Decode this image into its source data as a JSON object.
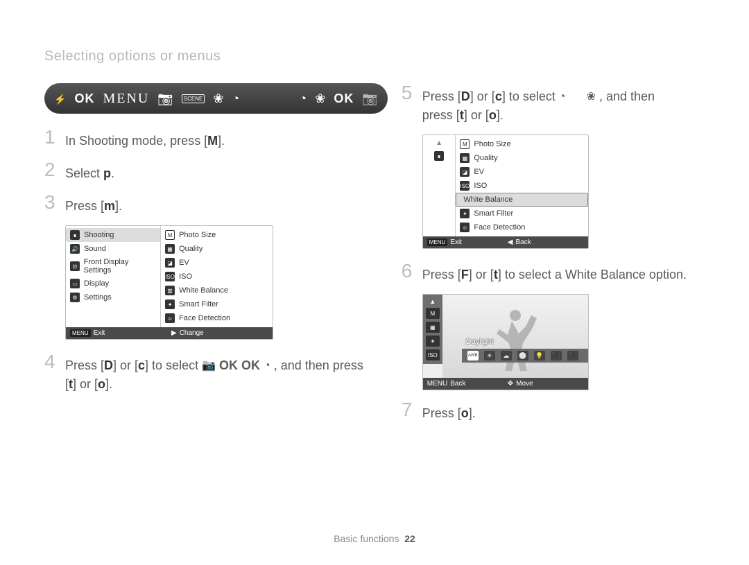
{
  "header": {
    "title": "Selecting options or menus"
  },
  "darkbar": {
    "ok1": "OK",
    "menu": "MENU",
    "scene": "SCENE",
    "ok2": "OK"
  },
  "steps": {
    "s1": {
      "num": "1",
      "text_a": "In Shooting mode, press [",
      "key": "M",
      "text_b": "]."
    },
    "s2": {
      "num": "2",
      "text_a": "Select ",
      "key": "p",
      "text_b": "."
    },
    "s3": {
      "num": "3",
      "text_a": "Press [",
      "key": "m",
      "text_b": "]."
    },
    "s4": {
      "num": "4",
      "line1_a": "Press [",
      "line1_key1": "D",
      "line1_b": "] or [",
      "line1_key2": "c",
      "line1_c": "] to select ",
      "line1_icons_trail": ", and then press",
      "line2_a": "[",
      "line2_key1": "t",
      "line2_b": "] or [",
      "line2_key2": "o",
      "line2_c": "]."
    },
    "s5": {
      "num": "5",
      "line1_a": "Press [",
      "line1_key1": "D",
      "line1_b": "] or [",
      "line1_key2": "c",
      "line1_c": "] to select ",
      "line1_trail": ", and then",
      "line2_a": "press [",
      "line2_key1": "t",
      "line2_b": "] or [",
      "line2_key2": "o",
      "line2_c": "]."
    },
    "s6": {
      "num": "6",
      "text_a": "Press [",
      "key1": "F",
      "text_b": "] or [",
      "key2": "t",
      "text_c": "] to select a White Balance option."
    },
    "s7": {
      "num": "7",
      "text_a": "Press [",
      "key": "o",
      "text_b": "]."
    }
  },
  "shot1": {
    "left_items": [
      "Shooting",
      "Sound",
      "Front Display Settings",
      "Display",
      "Settings"
    ],
    "right_items": [
      "Photo Size",
      "Quality",
      "EV",
      "ISO",
      "White Balance",
      "Smart Filter",
      "Face Detection"
    ],
    "footer_left_label": "MENU",
    "footer_left_text": "Exit",
    "footer_right_glyph": "▶",
    "footer_right_text": "Change"
  },
  "shot2": {
    "right_items": [
      "Photo Size",
      "Quality",
      "EV",
      "ISO",
      "White Balance",
      "Smart Filter",
      "Face Detection"
    ],
    "selected": "White Balance",
    "footer_left_label": "MENU",
    "footer_left_text": "Exit",
    "footer_right_glyph": "◀",
    "footer_right_text": "Back"
  },
  "wbshot": {
    "caption": "Daylight",
    "side_labels": [
      "M",
      "▦",
      "☀",
      "ISO"
    ],
    "strip_icons": [
      "AWB",
      "☀",
      "☁",
      "⚪",
      "💡",
      "⬛",
      "⬛"
    ],
    "footer_left_label": "MENU",
    "footer_left_text": "Back",
    "footer_right_glyph": "✥",
    "footer_right_text": "Move"
  },
  "footer": {
    "section": "Basic functions",
    "page": "22"
  }
}
